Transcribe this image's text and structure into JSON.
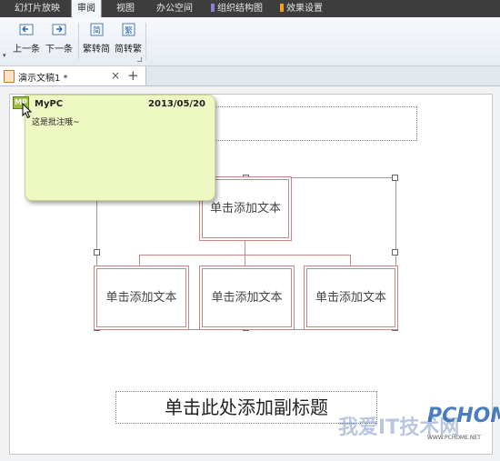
{
  "menu": {
    "tabs": [
      {
        "label": "幻灯片放映",
        "active": false
      },
      {
        "label": "审阅",
        "active": true
      },
      {
        "label": "视图",
        "active": false
      },
      {
        "label": "办公空间",
        "active": false
      },
      {
        "label": "组织结构图",
        "active": false,
        "flag_color": "#8a7fd6"
      },
      {
        "label": "效果设置",
        "active": false,
        "flag_color": "#f0a31a"
      }
    ]
  },
  "ribbon": {
    "prev_label": "上一条",
    "next_label": "下一条",
    "trad_label": "繁转简",
    "simp_label": "简转繁",
    "trad_glyph": "简",
    "simp_glyph": "繁"
  },
  "doc_tab": {
    "label": "演示文稿1 *",
    "close": "×",
    "add": "+"
  },
  "comment": {
    "marker": "MP",
    "author": "MyPC",
    "date": "2013/05/20",
    "text": "这是批注哦~"
  },
  "org_chart": {
    "top_node": "单击添加文本",
    "child_nodes": [
      "单击添加文本",
      "单击添加文本",
      "单击添加文本"
    ]
  },
  "subtitle_placeholder": "单击此处添加副标题",
  "watermark": {
    "text": "我爱IT技术网",
    "logo": "PCHOME",
    "url": "WWW.PCHOME.NET"
  },
  "colors": {
    "node_border": "#c98686",
    "comment_bg": "#eef8c2",
    "menubar_bg": "#3d3d3d"
  }
}
